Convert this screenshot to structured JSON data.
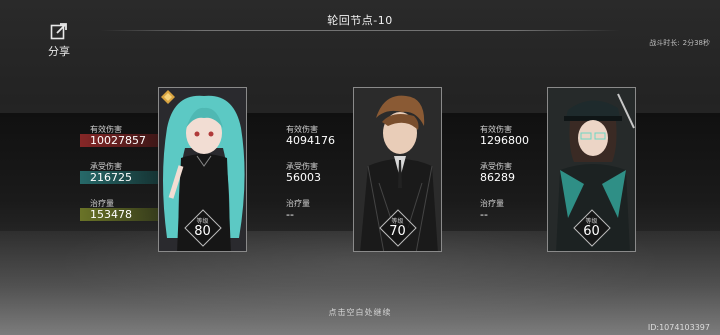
{
  "header": {
    "title": "轮回节点-10",
    "share_label": "分享",
    "duration_label": "战斗时长:",
    "duration_value": "2分38秒"
  },
  "stat_labels": {
    "damage": "有效伤害",
    "taken": "承受伤害",
    "heal": "治疗量",
    "level": "等级"
  },
  "characters": [
    {
      "level": "80",
      "damage": "10027857",
      "taken": "216725",
      "heal": "153478",
      "has_rank_icon": true
    },
    {
      "level": "70",
      "damage": "4094176",
      "taken": "56003",
      "heal": "--"
    },
    {
      "level": "60",
      "damage": "1296800",
      "taken": "86289",
      "heal": "--"
    }
  ],
  "colors": {
    "damage_bar": "#8c2828",
    "taken_bar": "#286e6e",
    "heal_bar": "#6e7828",
    "rank_icon": "#d9a441"
  },
  "footer": {
    "continue_text": "点击空白处继续",
    "user_id": "ID:1074103397"
  }
}
